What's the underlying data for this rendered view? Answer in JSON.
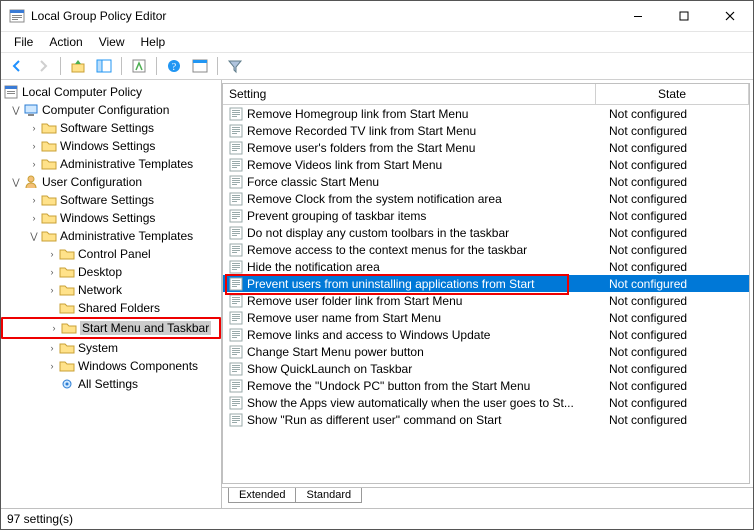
{
  "title": "Local Group Policy Editor",
  "menubar": [
    "File",
    "Action",
    "View",
    "Help"
  ],
  "tree": {
    "root": "Local Computer Policy",
    "computer_config": "Computer Configuration",
    "cc_software": "Software Settings",
    "cc_windows": "Windows Settings",
    "cc_admin": "Administrative Templates",
    "user_config": "User Configuration",
    "uc_software": "Software Settings",
    "uc_windows": "Windows Settings",
    "uc_admin": "Administrative Templates",
    "control_panel": "Control Panel",
    "desktop": "Desktop",
    "network": "Network",
    "shared_folders": "Shared Folders",
    "start_menu": "Start Menu and Taskbar",
    "system": "System",
    "win_components": "Windows Components",
    "all_settings": "All Settings"
  },
  "list_headers": {
    "setting": "Setting",
    "state": "State"
  },
  "state_not_configured": "Not configured",
  "items": [
    "Remove Homegroup link from Start Menu",
    "Remove Recorded TV link from Start Menu",
    "Remove user's folders from the Start Menu",
    "Remove Videos link from Start Menu",
    "Force classic Start Menu",
    "Remove Clock from the system notification area",
    "Prevent grouping of taskbar items",
    "Do not display any custom toolbars in the taskbar",
    "Remove access to the context menus for the taskbar",
    "Hide the notification area",
    "Prevent users from uninstalling applications from Start",
    "Remove user folder link from Start Menu",
    "Remove user name from Start Menu",
    "Remove links and access to Windows Update",
    "Change Start Menu power button",
    "Show QuickLaunch on Taskbar",
    "Remove the \"Undock PC\" button from the Start Menu",
    "Show the Apps view automatically when the user goes to St...",
    "Show \"Run as different user\" command on Start"
  ],
  "selected_index": 10,
  "tabs": [
    "Extended",
    "Standard"
  ],
  "active_tab": 1,
  "status": "97 setting(s)"
}
